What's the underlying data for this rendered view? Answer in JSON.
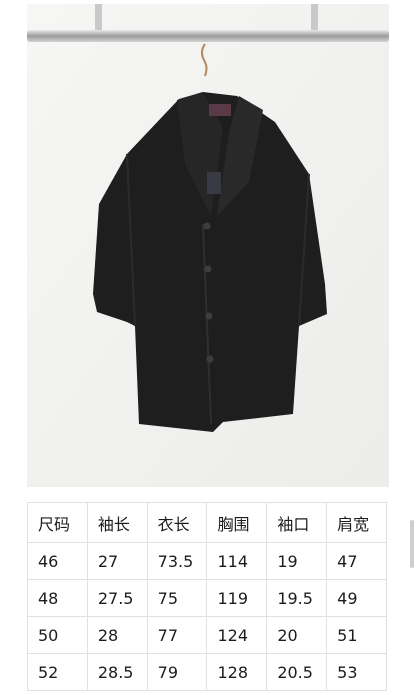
{
  "photo": {
    "subject": "shirt-on-hanger-photo",
    "garment_color": "#1e1e1f",
    "background_color": "#f3f3f1"
  },
  "size_table": {
    "headers": [
      "尺码",
      "袖长",
      "衣长",
      "胸围",
      "袖口",
      "肩宽"
    ],
    "rows": [
      [
        "46",
        "27",
        "73.5",
        "114",
        "19",
        "47"
      ],
      [
        "48",
        "27.5",
        "75",
        "119",
        "19.5",
        "49"
      ],
      [
        "50",
        "28",
        "77",
        "124",
        "20",
        "51"
      ],
      [
        "52",
        "28.5",
        "79",
        "128",
        "20.5",
        "53"
      ]
    ]
  }
}
